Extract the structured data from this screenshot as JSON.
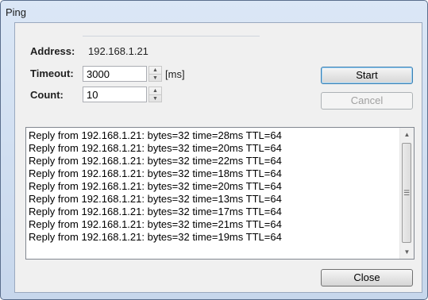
{
  "window": {
    "title": "Ping"
  },
  "form": {
    "address_label": "Address:",
    "address_value": "192.168.1.21",
    "timeout_label": "Timeout:",
    "timeout_value": "3000",
    "timeout_unit": "[ms]",
    "count_label": "Count:",
    "count_value": "10"
  },
  "buttons": {
    "start": "Start",
    "cancel": "Cancel",
    "close": "Close"
  },
  "output": {
    "lines": [
      "Reply from 192.168.1.21: bytes=32 time=28ms TTL=64",
      "Reply from 192.168.1.21: bytes=32 time=20ms TTL=64",
      "Reply from 192.168.1.21: bytes=32 time=22ms TTL=64",
      "Reply from 192.168.1.21: bytes=32 time=18ms TTL=64",
      "Reply from 192.168.1.21: bytes=32 time=20ms TTL=64",
      "Reply from 192.168.1.21: bytes=32 time=13ms TTL=64",
      "Reply from 192.168.1.21: bytes=32 time=17ms TTL=64",
      "Reply from 192.168.1.21: bytes=32 time=21ms TTL=64",
      "Reply from 192.168.1.21: bytes=32 time=19ms TTL=64"
    ]
  },
  "icons": {
    "spin_up": "spin-up-icon",
    "spin_down": "spin-down-icon",
    "scroll_up": "scroll-up-icon",
    "scroll_down": "scroll-down-icon",
    "scroll_grip": "scroll-grip-icon"
  }
}
